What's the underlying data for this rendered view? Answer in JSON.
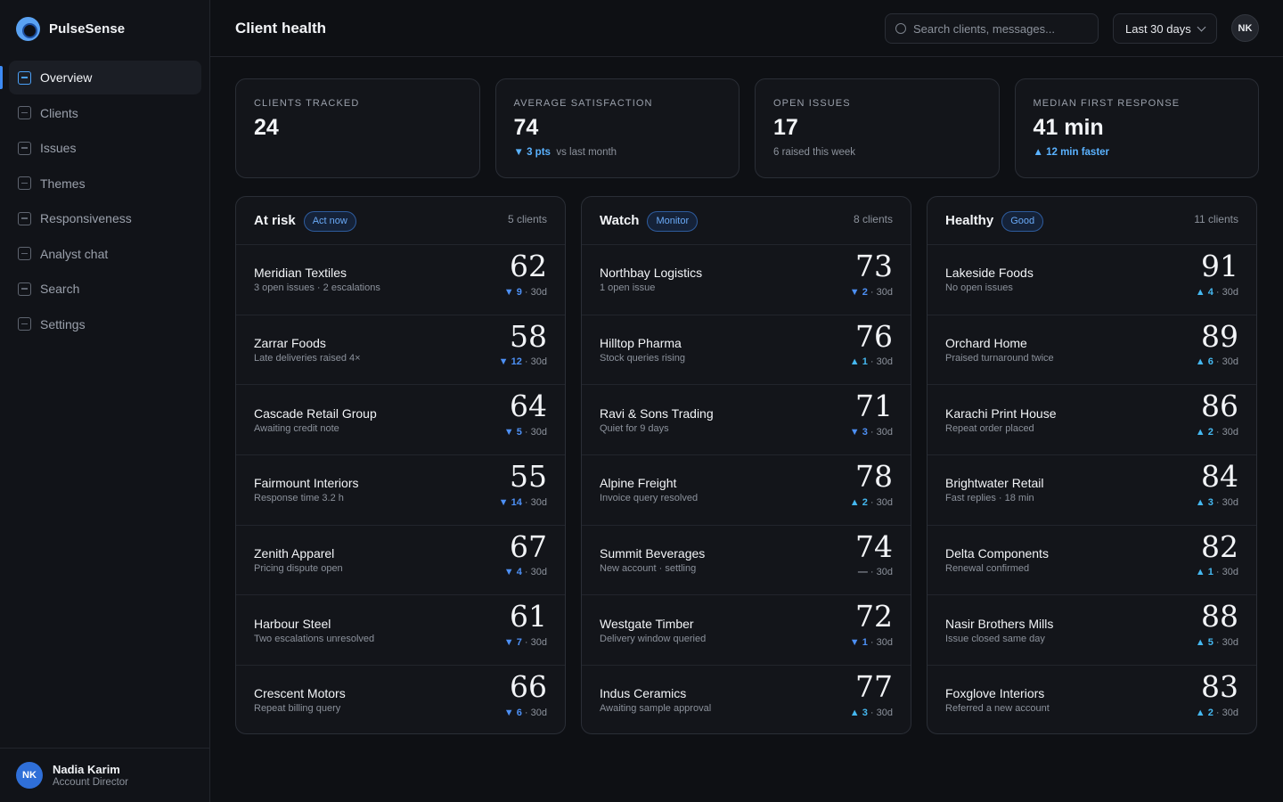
{
  "brand": {
    "name": "PulseSense"
  },
  "nav": [
    "Overview",
    "Clients",
    "Issues",
    "Themes",
    "Responsiveness",
    "Analyst chat",
    "Search",
    "Settings"
  ],
  "user": {
    "initials": "NK",
    "name": "Nadia Karim",
    "role": "Account Director"
  },
  "header": {
    "title": "Client health",
    "search_placeholder": "Search clients, messages...",
    "range": "Last 30 days",
    "avatar": "NK"
  },
  "kpis": [
    {
      "label": "Clients tracked",
      "value": "24",
      "highlight": "",
      "sub": ""
    },
    {
      "label": "Average satisfaction",
      "value": "74",
      "highlight": "▼ 3 pts",
      "sub": "vs last month"
    },
    {
      "label": "Open issues",
      "value": "17",
      "highlight": "",
      "sub": "6 raised this week"
    },
    {
      "label": "Median first response",
      "value": "41 min",
      "highlight": "▲ 12 min faster",
      "sub": ""
    }
  ],
  "columns": [
    {
      "title": "At risk",
      "tag": "Act now",
      "count": "5 clients",
      "rows": [
        {
          "name": "Meridian Textiles",
          "note": "3 open issues · 2 escalations",
          "score": "62",
          "dir": "down",
          "delta": "9",
          "period": "· 30d"
        },
        {
          "name": "Zarrar Foods",
          "note": "Late deliveries raised 4×",
          "score": "58",
          "dir": "down",
          "delta": "12",
          "period": "· 30d"
        },
        {
          "name": "Cascade Retail Group",
          "note": "Awaiting credit note",
          "score": "64",
          "dir": "down",
          "delta": "5",
          "period": "· 30d"
        },
        {
          "name": "Fairmount Interiors",
          "note": "Response time 3.2 h",
          "score": "55",
          "dir": "down",
          "delta": "14",
          "period": "· 30d"
        },
        {
          "name": "Zenith Apparel",
          "note": "Pricing dispute open",
          "score": "67",
          "dir": "down",
          "delta": "4",
          "period": "· 30d"
        },
        {
          "name": "Harbour Steel",
          "note": "Two escalations unresolved",
          "score": "61",
          "dir": "down",
          "delta": "7",
          "period": "· 30d"
        },
        {
          "name": "Crescent Motors",
          "note": "Repeat billing query",
          "score": "66",
          "dir": "down",
          "delta": "6",
          "period": "· 30d"
        }
      ]
    },
    {
      "title": "Watch",
      "tag": "Monitor",
      "count": "8 clients",
      "rows": [
        {
          "name": "Northbay Logistics",
          "note": "1 open issue",
          "score": "73",
          "dir": "down",
          "delta": "2",
          "period": "· 30d"
        },
        {
          "name": "Hilltop Pharma",
          "note": "Stock queries rising",
          "score": "76",
          "dir": "up",
          "delta": "1",
          "period": "· 30d"
        },
        {
          "name": "Ravi & Sons Trading",
          "note": "Quiet for 9 days",
          "score": "71",
          "dir": "down",
          "delta": "3",
          "period": "· 30d"
        },
        {
          "name": "Alpine Freight",
          "note": "Invoice query resolved",
          "score": "78",
          "dir": "up",
          "delta": "2",
          "period": "· 30d"
        },
        {
          "name": "Summit Beverages",
          "note": "New account · settling",
          "score": "74",
          "dir": "flat",
          "delta": "—",
          "period": "· 30d"
        },
        {
          "name": "Westgate Timber",
          "note": "Delivery window queried",
          "score": "72",
          "dir": "down",
          "delta": "1",
          "period": "· 30d"
        },
        {
          "name": "Indus Ceramics",
          "note": "Awaiting sample approval",
          "score": "77",
          "dir": "up",
          "delta": "3",
          "period": "· 30d"
        }
      ]
    },
    {
      "title": "Healthy",
      "tag": "Good",
      "count": "11 clients",
      "rows": [
        {
          "name": "Lakeside Foods",
          "note": "No open issues",
          "score": "91",
          "dir": "up",
          "delta": "4",
          "period": "· 30d"
        },
        {
          "name": "Orchard Home",
          "note": "Praised turnaround twice",
          "score": "89",
          "dir": "up",
          "delta": "6",
          "period": "· 30d"
        },
        {
          "name": "Karachi Print House",
          "note": "Repeat order placed",
          "score": "86",
          "dir": "up",
          "delta": "2",
          "period": "· 30d"
        },
        {
          "name": "Brightwater Retail",
          "note": "Fast replies · 18 min",
          "score": "84",
          "dir": "up",
          "delta": "3",
          "period": "· 30d"
        },
        {
          "name": "Delta Components",
          "note": "Renewal confirmed",
          "score": "82",
          "dir": "up",
          "delta": "1",
          "period": "· 30d"
        },
        {
          "name": "Nasir Brothers Mills",
          "note": "Issue closed same day",
          "score": "88",
          "dir": "up",
          "delta": "5",
          "period": "· 30d"
        },
        {
          "name": "Foxglove Interiors",
          "note": "Referred a new account",
          "score": "83",
          "dir": "up",
          "delta": "2",
          "period": "· 30d"
        }
      ]
    }
  ]
}
